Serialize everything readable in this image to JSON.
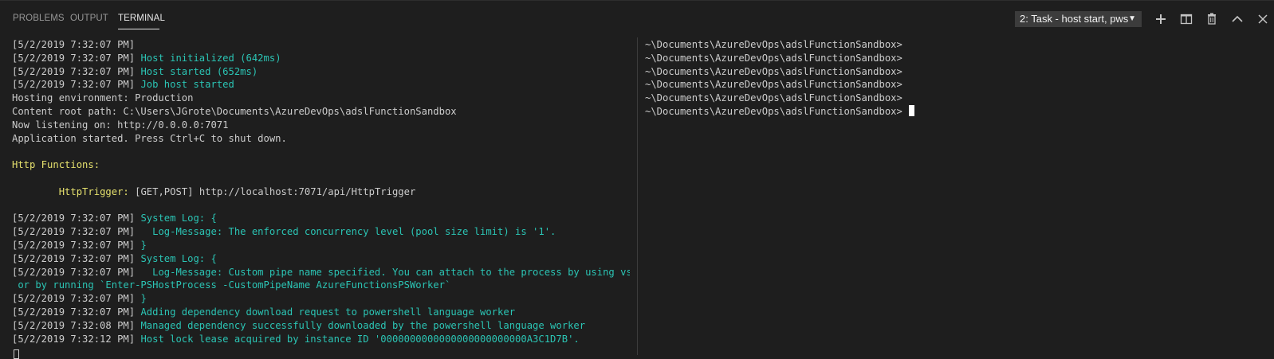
{
  "tabs": [
    {
      "label": "PROBLEMS",
      "active": false
    },
    {
      "label": "OUTPUT",
      "active": false
    },
    {
      "label": "TERMINAL",
      "active": true
    }
  ],
  "terminal_select": {
    "value": "2: Task - host start, pws"
  },
  "actions": [
    {
      "name": "new-terminal",
      "icon": "plus-icon"
    },
    {
      "name": "split-terminal",
      "icon": "split-icon"
    },
    {
      "name": "kill-terminal",
      "icon": "trash-icon"
    },
    {
      "name": "maximize-panel",
      "icon": "chevron-up-icon"
    },
    {
      "name": "close-panel",
      "icon": "close-icon"
    }
  ],
  "colors": {
    "background": "#1e1e1e",
    "text": "#cccccc",
    "cyan": "#2bc4b4",
    "yellow": "#e5e06d",
    "select_bg": "#3c3c3c"
  },
  "left_terminal": {
    "lines": [
      {
        "ts": "[5/2/2019 7:32:07 PM]",
        "msg": "",
        "color": "cyan"
      },
      {
        "ts": "[5/2/2019 7:32:07 PM] ",
        "msg": "Host initialized (642ms)",
        "color": "cyan"
      },
      {
        "ts": "[5/2/2019 7:32:07 PM] ",
        "msg": "Host started (652ms)",
        "color": "cyan"
      },
      {
        "ts": "[5/2/2019 7:32:07 PM] ",
        "msg": "Job host started",
        "color": "cyan"
      },
      {
        "ts": "Hosting environment: Production",
        "msg": "",
        "color": "cyan"
      },
      {
        "ts": "Content root path: C:\\Users\\JGrote\\Documents\\AzureDevOps\\adslFunctionSandbox",
        "msg": "",
        "color": "cyan"
      },
      {
        "ts": "Now listening on: http://0.0.0.0:7071",
        "msg": "",
        "color": "cyan"
      },
      {
        "ts": "Application started. Press Ctrl+C to shut down.",
        "msg": "",
        "color": "cyan"
      },
      {
        "ts": "",
        "msg": "",
        "color": "cyan"
      },
      {
        "ts": "",
        "msg": "Http Functions:",
        "color": "yellow"
      },
      {
        "ts": "",
        "msg": "",
        "color": "cyan"
      },
      {
        "ts": "        ",
        "msg": "HttpTrigger:",
        "color": "yellow",
        "tail": " [GET,POST] http://localhost:7071/api/HttpTrigger"
      },
      {
        "ts": "",
        "msg": "",
        "color": "cyan"
      },
      {
        "ts": "[5/2/2019 7:32:07 PM] ",
        "msg": "System Log: {",
        "color": "cyan"
      },
      {
        "ts": "[5/2/2019 7:32:07 PM] ",
        "msg": "  Log-Message: The enforced concurrency level (pool size limit) is '1'.",
        "color": "cyan"
      },
      {
        "ts": "[5/2/2019 7:32:07 PM] ",
        "msg": "}",
        "color": "cyan"
      },
      {
        "ts": "[5/2/2019 7:32:07 PM] ",
        "msg": "System Log: {",
        "color": "cyan"
      },
      {
        "ts": "[5/2/2019 7:32:07 PM] ",
        "msg": "  Log-Message: Custom pipe name specified. You can attach to the process by using vscode",
        "color": "cyan"
      },
      {
        "ts": "",
        "msg": " or by running `Enter-PSHostProcess -CustomPipeName AzureFunctionsPSWorker`",
        "color": "cyan"
      },
      {
        "ts": "[5/2/2019 7:32:07 PM] ",
        "msg": "}",
        "color": "cyan"
      },
      {
        "ts": "[5/2/2019 7:32:07 PM] ",
        "msg": "Adding dependency download request to powershell language worker",
        "color": "cyan"
      },
      {
        "ts": "[5/2/2019 7:32:08 PM] ",
        "msg": "Managed dependency successfully downloaded by the powershell language worker",
        "color": "cyan"
      },
      {
        "ts": "[5/2/2019 7:32:12 PM] ",
        "msg": "Host lock lease acquired by instance ID '0000000000000000000000000A3C1D7B'.",
        "color": "cyan"
      }
    ]
  },
  "right_terminal": {
    "prompt_lines": [
      "~\\Documents\\AzureDevOps\\adslFunctionSandbox>",
      "~\\Documents\\AzureDevOps\\adslFunctionSandbox>",
      "~\\Documents\\AzureDevOps\\adslFunctionSandbox>",
      "~\\Documents\\AzureDevOps\\adslFunctionSandbox>",
      "~\\Documents\\AzureDevOps\\adslFunctionSandbox>",
      "~\\Documents\\AzureDevOps\\adslFunctionSandbox> "
    ]
  }
}
